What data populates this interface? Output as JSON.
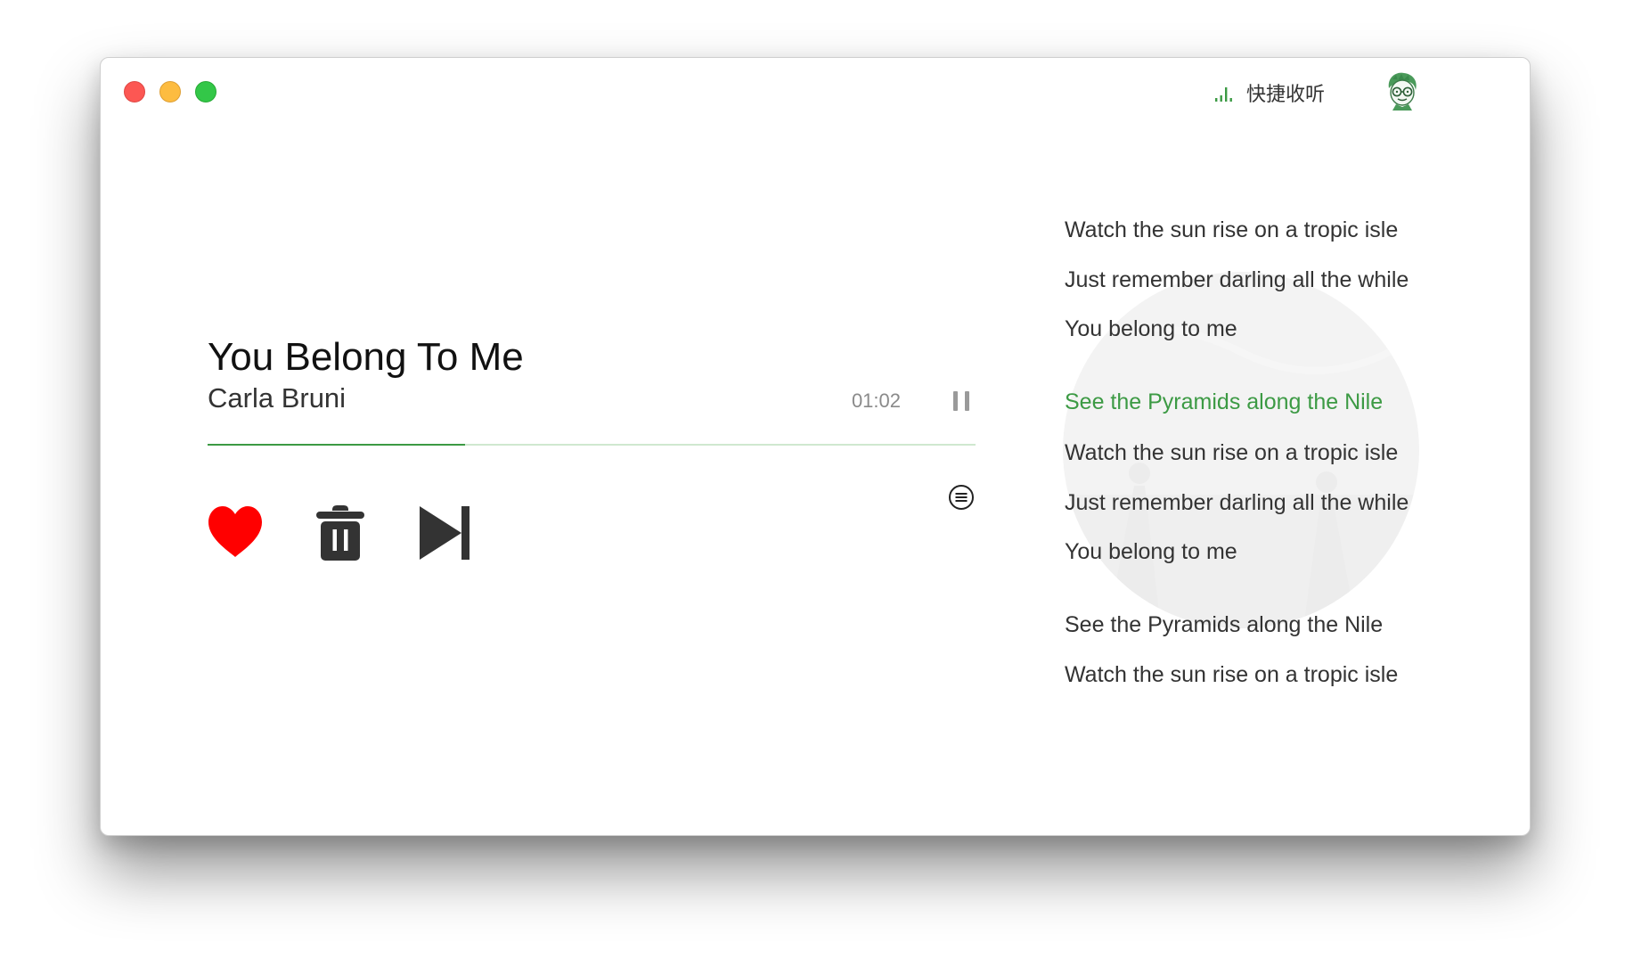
{
  "window": {
    "controls": [
      "close",
      "minimize",
      "zoom"
    ]
  },
  "header": {
    "quick_listen_label": "快捷收听",
    "quick_listen_icon": "bars-icon",
    "avatar_icon": "avatar-icon"
  },
  "player": {
    "title": "You Belong To Me",
    "artist": "Carla Bruni",
    "time": "01:02",
    "progress_percent": 33.5,
    "accent_color": "#3c9a44",
    "like_color": "#ff0000",
    "icons": {
      "pause": "pause-icon",
      "lyrics_toggle": "lyrics-list-icon",
      "like": "heart-icon",
      "trash": "trash-icon",
      "next": "skip-next-icon"
    }
  },
  "lyrics": {
    "lines": [
      "Watch the sun rise on a tropic isle",
      "Just remember darling all the while",
      "You belong to me",
      "See the Pyramids along the Nile",
      "Watch the sun rise on a tropic isle",
      "Just remember darling all the while",
      "You belong to me",
      "See the Pyramids along the Nile",
      "Watch the sun rise on a tropic isle"
    ],
    "active_index": 3
  }
}
